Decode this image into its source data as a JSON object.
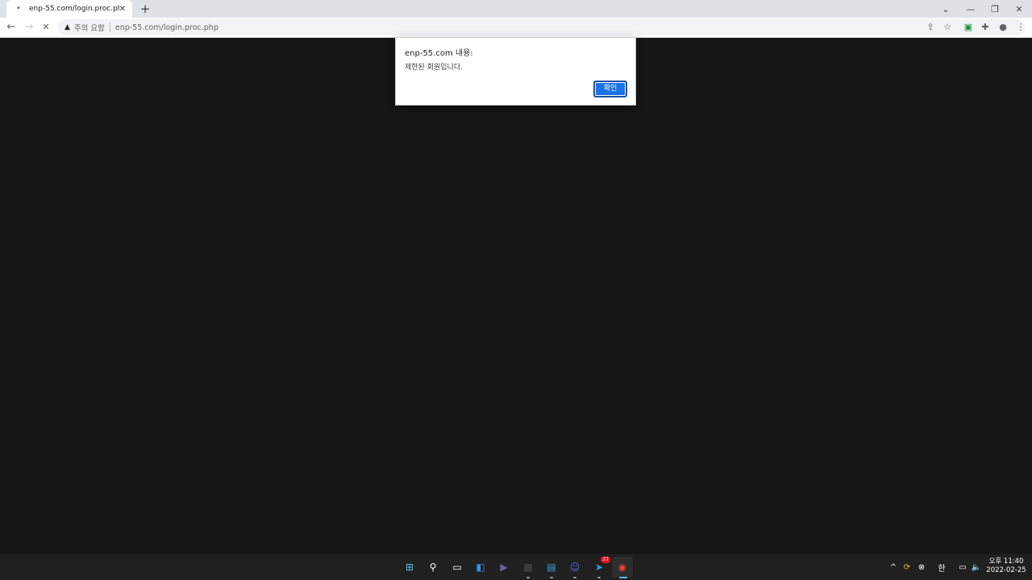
{
  "browser": {
    "tab": {
      "favicon": "loading-dot-icon",
      "title": "enp-55.com/login.proc.php",
      "close": "✕"
    },
    "new_tab": "+",
    "window_controls": {
      "tabsearch": "⌄",
      "minimize": "—",
      "restore": "❐",
      "close": "✕"
    },
    "toolbar": {
      "back": "←",
      "forward": "→",
      "stop": "✕",
      "security_label": "주의 요함",
      "url": "enp-55.com/login.proc.php",
      "share": "⇪",
      "bookmark": "☆",
      "extension": "▣",
      "puzzle": "✚",
      "profile": "●",
      "menu": "⋮"
    }
  },
  "dialog": {
    "title": "enp-55.com 내용:",
    "message": "제한된 회원입니다.",
    "ok_label": "확인"
  },
  "taskbar": {
    "apps": [
      {
        "name": "start",
        "glyph": "⊞",
        "color": "#4cc2ff"
      },
      {
        "name": "search",
        "glyph": "⚲",
        "color": "#ffffff"
      },
      {
        "name": "task-view",
        "glyph": "▭",
        "color": "#ffffff"
      },
      {
        "name": "widgets",
        "glyph": "◧",
        "color": "#3a8ee6"
      },
      {
        "name": "teams",
        "glyph": "▶",
        "color": "#6264a7"
      },
      {
        "name": "calculator",
        "glyph": "▦",
        "color": "#4a4a4a"
      },
      {
        "name": "notepad",
        "glyph": "▤",
        "color": "#3ca4e6"
      },
      {
        "name": "discord",
        "glyph": "☺",
        "color": "#5865f2"
      },
      {
        "name": "telegram",
        "glyph": "➤",
        "color": "#2aa3df",
        "badge": "27"
      },
      {
        "name": "chrome",
        "glyph": "◉",
        "color": "#ea4335"
      }
    ],
    "tray": {
      "chevron": "^",
      "ime": "한",
      "volume": "🔈"
    },
    "clock": {
      "time": "오후 11:40",
      "date": "2022-02-25"
    }
  }
}
